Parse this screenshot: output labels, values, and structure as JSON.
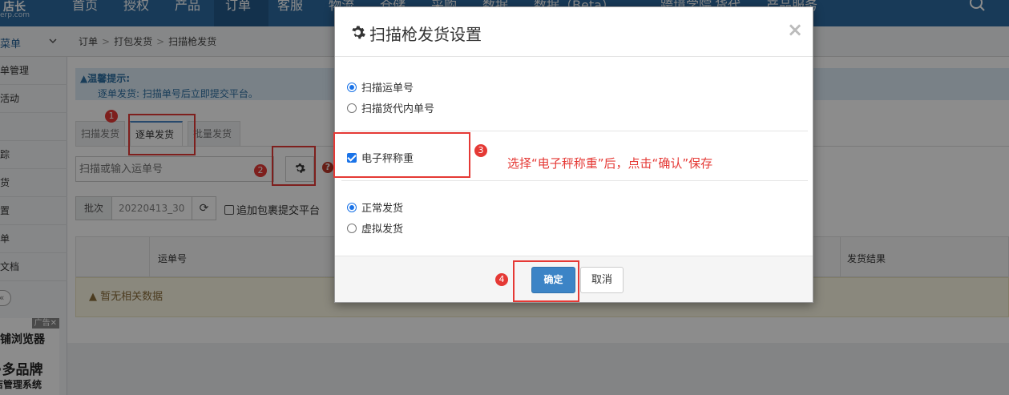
{
  "topnav": {
    "logo_text": "店长",
    "logo_sub": "erp.com",
    "items": [
      "首页",
      "授权",
      "产品",
      "订单",
      "客服",
      "物流",
      "仓储",
      "采购",
      "数据",
      "数据（Beta）",
      "跨境学院",
      "货代",
      "产品服务"
    ],
    "active_index": 3
  },
  "sidebar": {
    "header": "菜单",
    "items": [
      "单管理",
      "活动",
      "",
      "踪",
      "货",
      "置",
      "单",
      "文档"
    ],
    "collapse": "«"
  },
  "ad": {
    "badge": "广告✕",
    "line1": "店铺浏览器",
    "line2": "·多品牌",
    "line3": "店管理系统"
  },
  "breadcrumb": [
    "订单",
    "打包发货",
    "扫描枪发货"
  ],
  "tip": {
    "title": "温馨提示:",
    "text": "逐单发货: 扫描单号后立即提交平台。"
  },
  "tabs": [
    "扫描发货",
    "逐单发货",
    "批量发货"
  ],
  "active_tab": 1,
  "scan": {
    "placeholder": "扫描或输入运单号"
  },
  "batch": {
    "label": "批次",
    "value": "20220413_30",
    "append_label": "追加包裹提交平台"
  },
  "table": {
    "col_tracking": "运单号",
    "col_result": "发货结果",
    "empty": "暂无相关数据"
  },
  "modal": {
    "title": "扫描枪发货设置",
    "scan_options": [
      "扫描运单号",
      "扫描货代内单号"
    ],
    "scan_selected": 0,
    "scale_label": "电子秤称重",
    "scale_checked": true,
    "ship_options": [
      "正常发货",
      "虚拟发货"
    ],
    "ship_selected": 0,
    "ok": "确定",
    "cancel": "取消"
  },
  "annotations": {
    "badges": [
      "1",
      "2",
      "3",
      "4"
    ],
    "note": "选择“电子秤称重”后，点击“确认”保存"
  },
  "colors": {
    "nav": "#2c6aa0",
    "annotation": "#e53935",
    "primary": "#3c84c6"
  }
}
